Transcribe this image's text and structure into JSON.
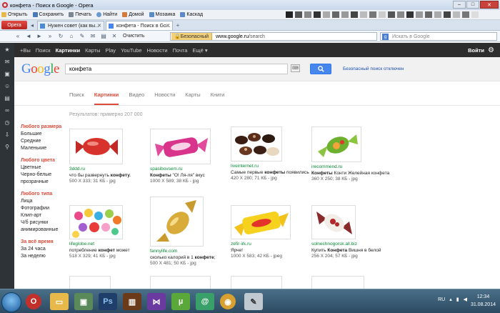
{
  "window": {
    "title": "конфета - Поиск в Google - Opera"
  },
  "menubar": {
    "items": [
      "Открыть",
      "Сохранить",
      "Печать",
      "Найти",
      "Домой",
      "Мозаика",
      "Каскад"
    ]
  },
  "tabs": {
    "opera_label": "Opera",
    "items": [
      "Нужен совет (как вы...",
      "конфета - Поиск в Go..."
    ]
  },
  "addressbar": {
    "clear_label": "Очистить",
    "secure_label": "Безопасный",
    "url_host": "www.google.ru",
    "url_path": "/search",
    "search_placeholder": "Искать в Google"
  },
  "gbar": {
    "items": [
      "+Вы",
      "Поиск",
      "Картинки",
      "Карты",
      "Play",
      "YouTube",
      "Новости",
      "Почта",
      "Ещё ▾"
    ],
    "signin": "Войти"
  },
  "google": {
    "logo": "Google",
    "query": "конфета",
    "safesearch": "Безопасный поиск отключен"
  },
  "search_tabs": [
    "Поиск",
    "Картинки",
    "Видео",
    "Новости",
    "Карты",
    "Книги"
  ],
  "result_count": "Результатов: примерно 207 000",
  "filters": [
    {
      "heading": "Любого размера",
      "items": [
        "Большие",
        "Средние",
        "Маленькие"
      ]
    },
    {
      "heading": "Любого цвета",
      "items": [
        "Цветные",
        "Черно-белые",
        "прозрачные"
      ]
    },
    {
      "heading": "Любого типа",
      "items": [
        "Лица",
        "Фотографии",
        "Клип-арт",
        "Ч/б рисунки",
        "анимированные"
      ]
    },
    {
      "heading": "За всё время",
      "items": [
        "За 24 часа",
        "За неделю"
      ]
    }
  ],
  "results": [
    {
      "site": "3ddd.ru",
      "desc_pre": "что бы развернуть ",
      "desc_bold": "конфету",
      "desc_post": ".",
      "meta": "500 X 333; 31 КБ - jpg"
    },
    {
      "site": "spasibovsem.ru",
      "desc_pre": "",
      "desc_bold": "Конфеты",
      "desc_post": " \"О! Ля-ля\" вкус",
      "meta": "1000 X 589; 38 КБ - jpg"
    },
    {
      "site": "liveinternet.ru",
      "desc_pre": "Самые первые ",
      "desc_bold": "конфеты",
      "desc_post": " появились",
      "meta": "420 X 280; 71 КБ - jpg"
    },
    {
      "site": "irecommend.ru",
      "desc_pre": "",
      "desc_bold": "Конфеты",
      "desc_post": " Конти Желейная конфета",
      "meta": "360 X 250; 38 КБ - jpg"
    },
    {
      "site": "lifeglobe.net",
      "desc_pre": "потребление ",
      "desc_bold": "конфет",
      "desc_post": " может",
      "meta": "518 X 329; 41 КБ - jpg"
    },
    {
      "site": "fannylife.com",
      "desc_pre": "сколько калорий в 1 ",
      "desc_bold": "конфете",
      "desc_post": ";",
      "meta": "500 X 481; 50 КБ - jpg"
    },
    {
      "site": "zefir-irk.ru",
      "desc_pre": "Ярче!",
      "desc_bold": "",
      "desc_post": "",
      "meta": "1000 X 583; 42 КБ - jpeg"
    },
    {
      "site": "solnechnogorsk.all.biz",
      "desc_pre": "Купить ",
      "desc_bold": "Конфета",
      "desc_post": " Вишня в белой",
      "meta": "256 X 204; 57 КБ - jpg"
    }
  ],
  "taskbar": {
    "lang": "RU",
    "time": "12:34",
    "date": "31.08.2014"
  },
  "colors": {
    "google_red": "#dd4b39",
    "google_blue": "#4787ed",
    "link_green": "#0a8a35",
    "gbar_bg": "#2d2d2d"
  }
}
